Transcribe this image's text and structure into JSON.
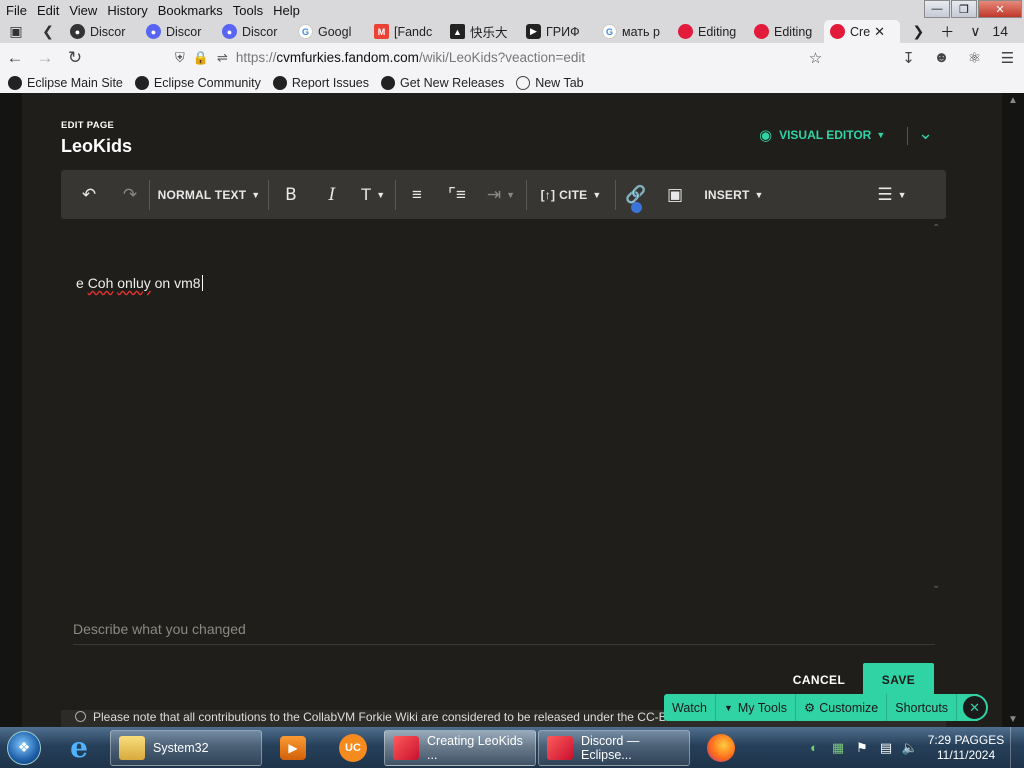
{
  "menubar": {
    "items": [
      "File",
      "Edit",
      "View",
      "History",
      "Bookmarks",
      "Tools",
      "Help"
    ]
  },
  "tabs": [
    {
      "label": "Discor",
      "icon": "discord-icon",
      "color": "#333333"
    },
    {
      "label": "Discor",
      "icon": "discord-icon",
      "color": "#5865f2"
    },
    {
      "label": "Discor",
      "icon": "discord-icon",
      "color": "#5865f2"
    },
    {
      "label": "Googl",
      "icon": "google-icon",
      "color": "#4285f4"
    },
    {
      "label": "[Fandc",
      "icon": "gmail-icon",
      "color": "#ea4335"
    },
    {
      "label": "快乐大",
      "icon": "cat-icon",
      "color": "#222222"
    },
    {
      "label": "ГРИФ",
      "icon": "youtube-icon",
      "color": "#222222"
    },
    {
      "label": "мать р",
      "icon": "google-icon",
      "color": "#4285f4"
    },
    {
      "label": "Editing",
      "icon": "fandom-icon",
      "color": "#e21b3c"
    },
    {
      "label": "Editing",
      "icon": "fandom-icon",
      "color": "#e21b3c"
    },
    {
      "label": "Cre",
      "icon": "fandom-icon",
      "color": "#e21b3c",
      "active": true
    }
  ],
  "tab_count": "14",
  "url": {
    "prefix": "https://",
    "domain": "cvmfurkies.fandom.com",
    "path": "/wiki/LeoKids?veaction=edit"
  },
  "bookmarks": [
    {
      "label": "Eclipse Main Site",
      "icon": "eclipse-icon"
    },
    {
      "label": "Eclipse Community",
      "icon": "eclipse-icon"
    },
    {
      "label": "Report Issues",
      "icon": "github-icon"
    },
    {
      "label": "Get New Releases",
      "icon": "github-icon"
    },
    {
      "label": "New Tab",
      "icon": "globe-icon"
    }
  ],
  "editor": {
    "edit_label": "EDIT PAGE",
    "page_title": "LeoKids",
    "visual_editor_label": "VISUAL EDITOR",
    "toolbar": {
      "normal_text": "NORMAL TEXT",
      "cite": "CITE",
      "insert": "INSERT"
    },
    "content_parts": [
      "e ",
      "Coh",
      " ",
      "onluy",
      " on vm8"
    ],
    "summary_placeholder": "Describe what you changed",
    "cancel_label": "CANCEL",
    "save_label": "SAVE",
    "notice": "Please note that all contributions to the CollabVM Forkie Wiki are considered to be released under the CC-BY-SA"
  },
  "wiki_toolbar": {
    "watch": "Watch",
    "my_tools": "My Tools",
    "customize": "Customize",
    "shortcuts": "Shortcuts"
  },
  "taskbar": {
    "windows": [
      {
        "label": "System32",
        "icon": "folder-icon"
      },
      {
        "label": "Creating LeoKids ...",
        "icon": "fandom-icon",
        "active": true
      },
      {
        "label": "Discord — Eclipse...",
        "icon": "fandom-icon"
      }
    ],
    "clock_time": "7:29 PAGGES",
    "clock_date": "11/11/2024"
  },
  "colors": {
    "accent": "#2fd3a4",
    "editor_bg": "#1f1e1a",
    "toolbar_bg": "#373632"
  }
}
